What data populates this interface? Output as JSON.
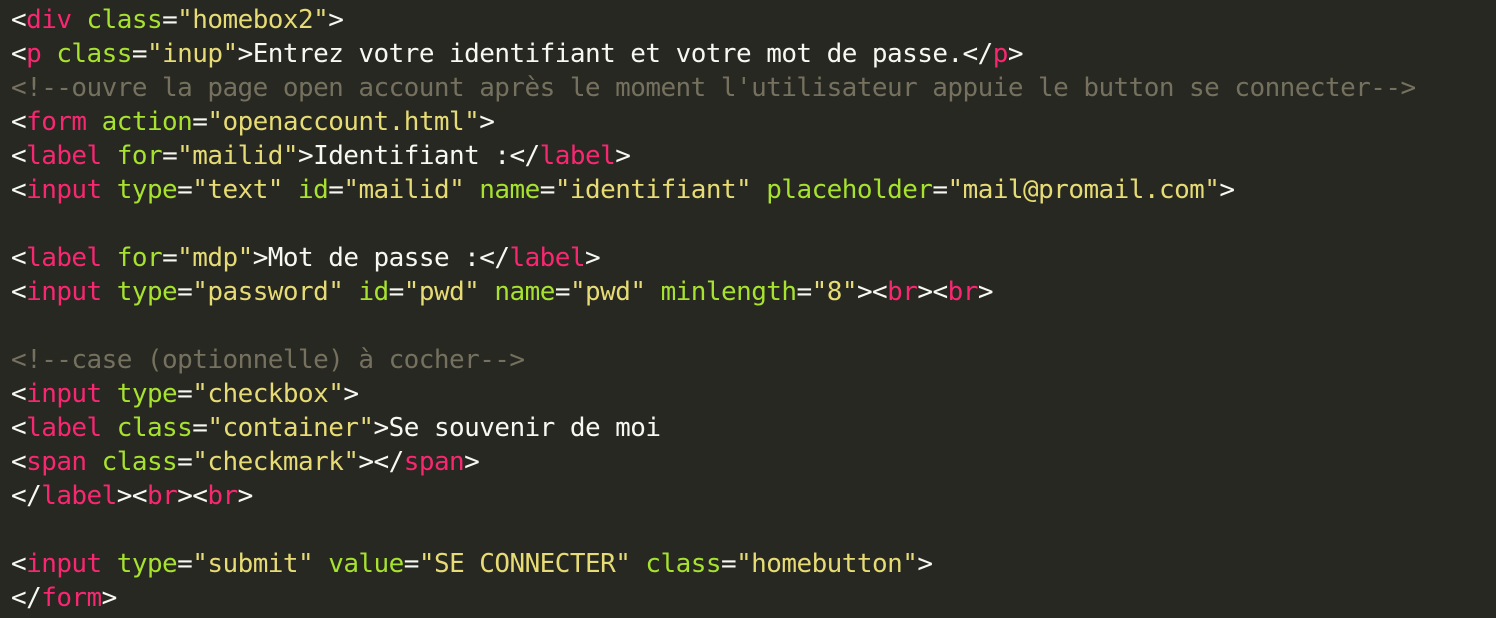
{
  "colors": {
    "background": "#272822",
    "punctuation": "#f8f8f2",
    "tag": "#f92672",
    "attribute": "#a6e22e",
    "string": "#e6db74",
    "comment": "#75715e",
    "text": "#f8f8f2"
  },
  "code": {
    "lines": [
      {
        "tokens": [
          {
            "k": "p",
            "t": "<"
          },
          {
            "k": "t",
            "t": "div"
          },
          {
            "k": "p",
            "t": " "
          },
          {
            "k": "a",
            "t": "class"
          },
          {
            "k": "p",
            "t": "="
          },
          {
            "k": "s",
            "t": "\"homebox2\""
          },
          {
            "k": "p",
            "t": ">"
          }
        ]
      },
      {
        "tokens": [
          {
            "k": "p",
            "t": "<"
          },
          {
            "k": "t",
            "t": "p"
          },
          {
            "k": "p",
            "t": " "
          },
          {
            "k": "a",
            "t": "class"
          },
          {
            "k": "p",
            "t": "="
          },
          {
            "k": "s",
            "t": "\"inup\""
          },
          {
            "k": "p",
            "t": ">Entrez votre identifiant et votre mot de passe.</"
          },
          {
            "k": "t",
            "t": "p"
          },
          {
            "k": "p",
            "t": ">"
          }
        ]
      },
      {
        "tokens": [
          {
            "k": "c",
            "t": "<!--ouvre la page open account après le moment l'utilisateur appuie le button se connecter-->"
          }
        ]
      },
      {
        "tokens": [
          {
            "k": "p",
            "t": "<"
          },
          {
            "k": "t",
            "t": "form"
          },
          {
            "k": "p",
            "t": " "
          },
          {
            "k": "a",
            "t": "action"
          },
          {
            "k": "p",
            "t": "="
          },
          {
            "k": "s",
            "t": "\"openaccount.html\""
          },
          {
            "k": "p",
            "t": ">"
          }
        ]
      },
      {
        "tokens": [
          {
            "k": "p",
            "t": "<"
          },
          {
            "k": "t",
            "t": "label"
          },
          {
            "k": "p",
            "t": " "
          },
          {
            "k": "a",
            "t": "for"
          },
          {
            "k": "p",
            "t": "="
          },
          {
            "k": "s",
            "t": "\"mailid\""
          },
          {
            "k": "p",
            "t": ">Identifiant :</"
          },
          {
            "k": "t",
            "t": "label"
          },
          {
            "k": "p",
            "t": ">"
          }
        ]
      },
      {
        "tokens": [
          {
            "k": "p",
            "t": "<"
          },
          {
            "k": "t",
            "t": "input"
          },
          {
            "k": "p",
            "t": " "
          },
          {
            "k": "a",
            "t": "type"
          },
          {
            "k": "p",
            "t": "="
          },
          {
            "k": "s",
            "t": "\"text\""
          },
          {
            "k": "p",
            "t": " "
          },
          {
            "k": "a",
            "t": "id"
          },
          {
            "k": "p",
            "t": "="
          },
          {
            "k": "s",
            "t": "\"mailid\""
          },
          {
            "k": "p",
            "t": " "
          },
          {
            "k": "a",
            "t": "name"
          },
          {
            "k": "p",
            "t": "="
          },
          {
            "k": "s",
            "t": "\"identifiant\""
          },
          {
            "k": "p",
            "t": " "
          },
          {
            "k": "a",
            "t": "placeholder"
          },
          {
            "k": "p",
            "t": "="
          },
          {
            "k": "s",
            "t": "\"mail@promail.com\""
          },
          {
            "k": "p",
            "t": ">"
          }
        ]
      },
      {
        "tokens": []
      },
      {
        "tokens": [
          {
            "k": "p",
            "t": "<"
          },
          {
            "k": "t",
            "t": "label"
          },
          {
            "k": "p",
            "t": " "
          },
          {
            "k": "a",
            "t": "for"
          },
          {
            "k": "p",
            "t": "="
          },
          {
            "k": "s",
            "t": "\"mdp\""
          },
          {
            "k": "p",
            "t": ">Mot de passe :</"
          },
          {
            "k": "t",
            "t": "label"
          },
          {
            "k": "p",
            "t": ">"
          }
        ]
      },
      {
        "tokens": [
          {
            "k": "p",
            "t": "<"
          },
          {
            "k": "t",
            "t": "input"
          },
          {
            "k": "p",
            "t": " "
          },
          {
            "k": "a",
            "t": "type"
          },
          {
            "k": "p",
            "t": "="
          },
          {
            "k": "s",
            "t": "\"password\""
          },
          {
            "k": "p",
            "t": " "
          },
          {
            "k": "a",
            "t": "id"
          },
          {
            "k": "p",
            "t": "="
          },
          {
            "k": "s",
            "t": "\"pwd\""
          },
          {
            "k": "p",
            "t": " "
          },
          {
            "k": "a",
            "t": "name"
          },
          {
            "k": "p",
            "t": "="
          },
          {
            "k": "s",
            "t": "\"pwd\""
          },
          {
            "k": "p",
            "t": " "
          },
          {
            "k": "a",
            "t": "minlength"
          },
          {
            "k": "p",
            "t": "="
          },
          {
            "k": "s",
            "t": "\"8\""
          },
          {
            "k": "p",
            "t": "><"
          },
          {
            "k": "t",
            "t": "br"
          },
          {
            "k": "p",
            "t": "><"
          },
          {
            "k": "t",
            "t": "br"
          },
          {
            "k": "p",
            "t": ">"
          }
        ]
      },
      {
        "tokens": []
      },
      {
        "tokens": [
          {
            "k": "c",
            "t": "<!--case (optionnelle) à cocher-->"
          }
        ]
      },
      {
        "tokens": [
          {
            "k": "p",
            "t": "<"
          },
          {
            "k": "t",
            "t": "input"
          },
          {
            "k": "p",
            "t": " "
          },
          {
            "k": "a",
            "t": "type"
          },
          {
            "k": "p",
            "t": "="
          },
          {
            "k": "s",
            "t": "\"checkbox\""
          },
          {
            "k": "p",
            "t": ">"
          }
        ]
      },
      {
        "tokens": [
          {
            "k": "p",
            "t": "<"
          },
          {
            "k": "t",
            "t": "label"
          },
          {
            "k": "p",
            "t": " "
          },
          {
            "k": "a",
            "t": "class"
          },
          {
            "k": "p",
            "t": "="
          },
          {
            "k": "s",
            "t": "\"container\""
          },
          {
            "k": "p",
            "t": ">Se souvenir de moi"
          }
        ]
      },
      {
        "tokens": [
          {
            "k": "p",
            "t": "<"
          },
          {
            "k": "t",
            "t": "span"
          },
          {
            "k": "p",
            "t": " "
          },
          {
            "k": "a",
            "t": "class"
          },
          {
            "k": "p",
            "t": "="
          },
          {
            "k": "s",
            "t": "\"checkmark\""
          },
          {
            "k": "p",
            "t": "></"
          },
          {
            "k": "t",
            "t": "span"
          },
          {
            "k": "p",
            "t": ">"
          }
        ]
      },
      {
        "tokens": [
          {
            "k": "p",
            "t": "</"
          },
          {
            "k": "t",
            "t": "label"
          },
          {
            "k": "p",
            "t": "><"
          },
          {
            "k": "t",
            "t": "br"
          },
          {
            "k": "p",
            "t": "><"
          },
          {
            "k": "t",
            "t": "br"
          },
          {
            "k": "p",
            "t": ">"
          }
        ]
      },
      {
        "tokens": []
      },
      {
        "tokens": [
          {
            "k": "p",
            "t": "<"
          },
          {
            "k": "t",
            "t": "input"
          },
          {
            "k": "p",
            "t": " "
          },
          {
            "k": "a",
            "t": "type"
          },
          {
            "k": "p",
            "t": "="
          },
          {
            "k": "s",
            "t": "\"submit\""
          },
          {
            "k": "p",
            "t": " "
          },
          {
            "k": "a",
            "t": "value"
          },
          {
            "k": "p",
            "t": "="
          },
          {
            "k": "s",
            "t": "\"SE CONNECTER\""
          },
          {
            "k": "p",
            "t": " "
          },
          {
            "k": "a",
            "t": "class"
          },
          {
            "k": "p",
            "t": "="
          },
          {
            "k": "s",
            "t": "\"homebutton\""
          },
          {
            "k": "p",
            "t": ">"
          }
        ]
      },
      {
        "tokens": [
          {
            "k": "p",
            "t": "</"
          },
          {
            "k": "t",
            "t": "form"
          },
          {
            "k": "p",
            "t": ">"
          }
        ]
      }
    ]
  }
}
